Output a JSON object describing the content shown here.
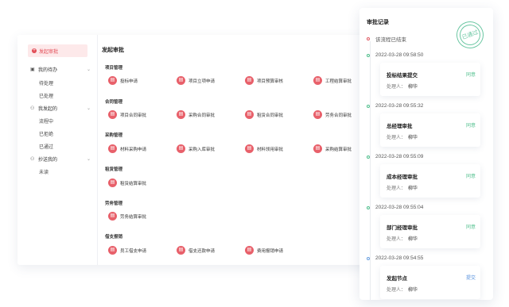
{
  "sidebar": {
    "start_label": "发起审批",
    "groups": [
      {
        "label": "我的待办",
        "icon": "inbox-icon",
        "items": [
          "待处理",
          "已处理"
        ]
      },
      {
        "label": "我发起的",
        "icon": "user-send-icon",
        "items": [
          "流程中",
          "已拒绝",
          "已通过"
        ]
      },
      {
        "label": "抄送我的",
        "icon": "cc-icon",
        "items": [
          "未读"
        ]
      }
    ]
  },
  "main": {
    "title": "发起审批",
    "sections": [
      {
        "title": "项目管理",
        "items": [
          "投标申请",
          "项目立项申请",
          "项目预算审核",
          "工程结算审批"
        ]
      },
      {
        "title": "合同管理",
        "items": [
          "项目合同审批",
          "采购合同审批",
          "租赁合同审批",
          "劳务合同审批"
        ]
      },
      {
        "title": "采购管理",
        "items": [
          "材料采购申请",
          "采购入库审批",
          "材料领用审批",
          "采购结算审批"
        ]
      },
      {
        "title": "租赁管理",
        "items": [
          "租赁结算审批"
        ]
      },
      {
        "title": "劳务管理",
        "items": [
          "劳务结算审批"
        ]
      },
      {
        "title": "借支报销",
        "items": [
          "员工借支申请",
          "借支还款申请",
          "费用报销申请"
        ]
      }
    ]
  },
  "record": {
    "title": "审批记录",
    "stamp": "已通过",
    "ended": "该流程已结束",
    "handler_label": "处理人：",
    "entries": [
      {
        "time": "2022-03-28 09:58:50",
        "name": "投标结果提交",
        "status": "同意",
        "handler": "柳华"
      },
      {
        "time": "2022-03-28 09:55:32",
        "name": "总经理审批",
        "status": "同意",
        "handler": "柳华"
      },
      {
        "time": "2022-03-28 09:55:09",
        "name": "成本经理审批",
        "status": "同意",
        "handler": "柳华"
      },
      {
        "time": "2022-03-28 09:55:04",
        "name": "部门经理审批",
        "status": "同意",
        "handler": "柳华"
      },
      {
        "time": "2022-03-28 09:54:55",
        "name": "发起节点",
        "status": "提交",
        "handler": "柳华"
      }
    ]
  },
  "colors": {
    "accent": "#e8606a",
    "approve": "#4fbf8c",
    "submit": "#5a93de"
  }
}
